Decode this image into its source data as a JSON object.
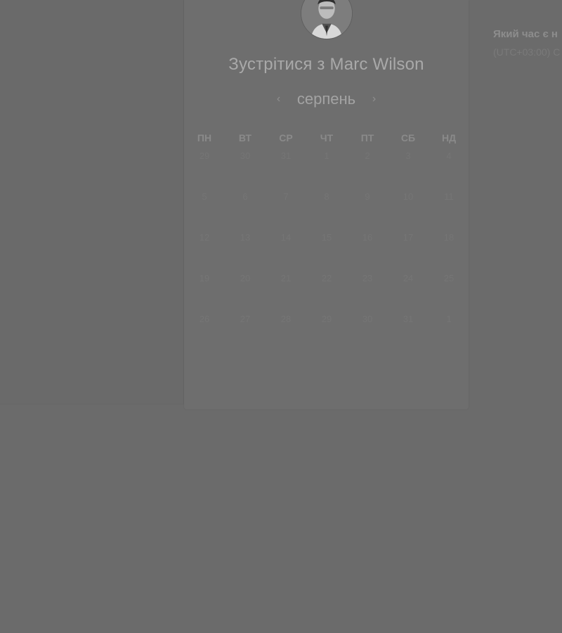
{
  "meeting": {
    "title": "Зустрітися з Marc Wilson"
  },
  "calendar": {
    "month_label": "серпень",
    "prev_icon": "chevron-left-icon",
    "next_icon": "chevron-right-icon",
    "weekdays": [
      "ПН",
      "ВТ",
      "СР",
      "ЧТ",
      "ПТ",
      "СБ",
      "НД"
    ],
    "weeks": [
      [
        "29",
        "30",
        "31",
        "1",
        "2",
        "3",
        "4"
      ],
      [
        "5",
        "6",
        "7",
        "8",
        "9",
        "10",
        "11"
      ],
      [
        "12",
        "13",
        "14",
        "15",
        "16",
        "17",
        "18"
      ],
      [
        "19",
        "20",
        "21",
        "22",
        "23",
        "24",
        "25"
      ],
      [
        "26",
        "27",
        "28",
        "29",
        "30",
        "31",
        "1"
      ]
    ]
  },
  "timezone": {
    "question": "Який час є н",
    "value": "(UTC+03:00) С"
  },
  "colors": {
    "overlay_background": "#6b6b6b",
    "card_background": "#6e6e6e",
    "title_text": "#a9a9a9"
  }
}
